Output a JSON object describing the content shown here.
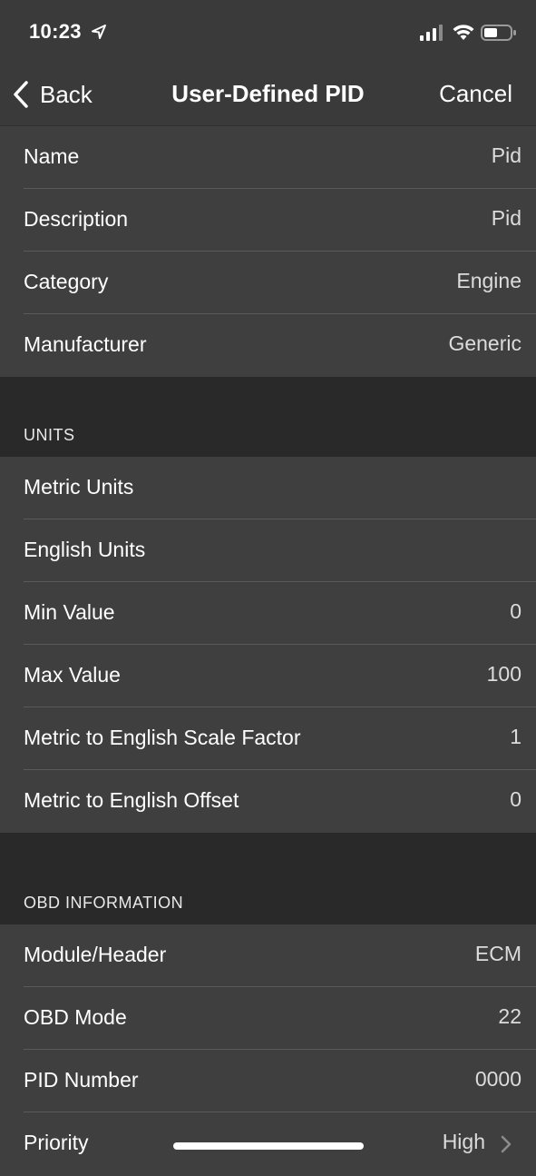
{
  "status_bar": {
    "time": "10:23"
  },
  "nav": {
    "back_label": "Back",
    "title": "User-Defined PID",
    "cancel_label": "Cancel"
  },
  "general": [
    {
      "label": "Name",
      "value": "Pid"
    },
    {
      "label": "Description",
      "value": "Pid"
    },
    {
      "label": "Category",
      "value": "Engine"
    },
    {
      "label": "Manufacturer",
      "value": "Generic"
    }
  ],
  "units": {
    "header": "UNITS",
    "rows": [
      {
        "label": "Metric Units",
        "value": ""
      },
      {
        "label": "English Units",
        "value": ""
      },
      {
        "label": "Min Value",
        "value": "0"
      },
      {
        "label": "Max Value",
        "value": "100"
      },
      {
        "label": "Metric to English Scale Factor",
        "value": "1"
      },
      {
        "label": "Metric to English Offset",
        "value": "0"
      }
    ]
  },
  "obd": {
    "header": "OBD INFORMATION",
    "rows": [
      {
        "label": "Module/Header",
        "value": "ECM"
      },
      {
        "label": "OBD Mode",
        "value": "22"
      },
      {
        "label": "PID Number",
        "value": "0000"
      },
      {
        "label": "Priority",
        "value": "High"
      }
    ]
  },
  "colors": {
    "background": "#292929",
    "cell": "#3f3f3f",
    "bar": "#3a3a3a",
    "text": "#ffffff"
  },
  "icons": [
    "location-arrow-icon",
    "cellular-signal-icon",
    "wifi-icon",
    "battery-icon",
    "chevron-left-icon",
    "chevron-right-icon"
  ]
}
